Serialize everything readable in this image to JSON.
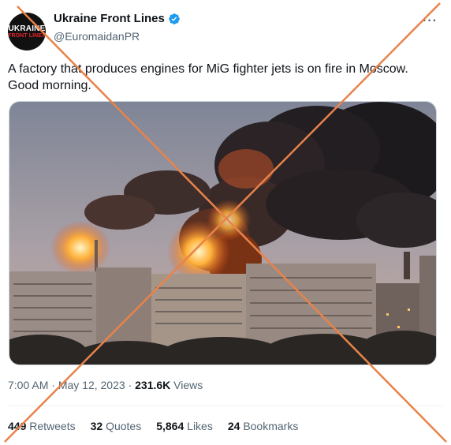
{
  "account": {
    "display_name": "Ukraine Front Lines",
    "handle": "@EuromaidanPR",
    "avatar_line1": "UKRAINE",
    "avatar_line2": "FRONT LINES",
    "verified_icon": "verified-badge-icon",
    "verified_color": "#1d9bf0"
  },
  "menu": {
    "more_icon": "more-horizontal-icon",
    "more_label": "···"
  },
  "tweet": {
    "text": "A factory that produces engines for MiG fighter jets is on fire in Moscow. Good morning."
  },
  "meta": {
    "time": "7:00 AM",
    "separator": "·",
    "date": "May 12, 2023",
    "separator2": "·",
    "views_count": "231.6K",
    "views_label": "Views"
  },
  "stats": [
    {
      "count": "449",
      "label": "Retweets"
    },
    {
      "count": "32",
      "label": "Quotes"
    },
    {
      "count": "5,864",
      "label": "Likes"
    },
    {
      "count": "24",
      "label": "Bookmarks"
    }
  ],
  "overlay": {
    "cross_color": "#e8834a"
  }
}
